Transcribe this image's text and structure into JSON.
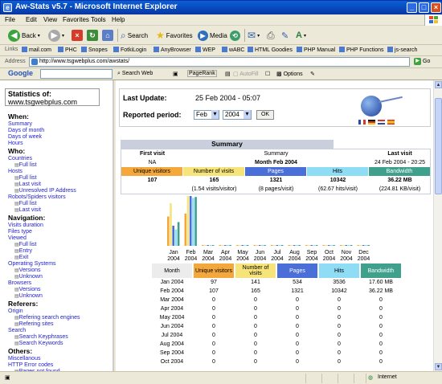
{
  "window": {
    "title": "Aw-Stats v5.7 - Microsoft Internet Explorer"
  },
  "menu": [
    "File",
    "Edit",
    "View",
    "Favorites",
    "Tools",
    "Help"
  ],
  "toolbar": {
    "back": "Back",
    "search": "Search",
    "favorites": "Favorites",
    "media": "Media"
  },
  "links": {
    "label": "Links",
    "items": [
      "mail.com",
      "PHC",
      "Snopes",
      "FotkiLogin",
      "AnyBrowser",
      "WEP",
      "wABC",
      "HTML Goodies",
      "PHP Manual",
      "PHP Functions",
      "js-search"
    ]
  },
  "address": {
    "label": "Address",
    "url": "http://www.tsgwebplus.com/awstats/",
    "go": "Go"
  },
  "googlebar": {
    "logo": "Google",
    "search_web": "Search Web",
    "pagerank": "PageRank",
    "autofill": "AutoFill",
    "options": "Options"
  },
  "sidebar": {
    "stats_label": "Statistics of:",
    "host": "www.tsgwebplus.com",
    "sections": [
      {
        "title": "When:",
        "links": [
          {
            "label": "Summary",
            "sub": false
          },
          {
            "label": "Days of month",
            "sub": false
          },
          {
            "label": "Days of week",
            "sub": false
          },
          {
            "label": "Hours",
            "sub": false
          }
        ]
      },
      {
        "title": "Who:",
        "links": [
          {
            "label": "Countries",
            "sub": false
          },
          {
            "label": "Full list",
            "sub": true
          },
          {
            "label": "Hosts",
            "sub": false
          },
          {
            "label": "Full list",
            "sub": true
          },
          {
            "label": "Last visit",
            "sub": true
          },
          {
            "label": "Unresolved IP Address",
            "sub": true
          },
          {
            "label": "Robots/Spiders visitors",
            "sub": false
          },
          {
            "label": "Full list",
            "sub": true
          },
          {
            "label": "Last visit",
            "sub": true
          }
        ]
      },
      {
        "title": "Navigation:",
        "links": [
          {
            "label": "Visits duration",
            "sub": false
          },
          {
            "label": "Files type",
            "sub": false
          },
          {
            "label": "Viewed",
            "sub": false
          },
          {
            "label": "Full list",
            "sub": true
          },
          {
            "label": "Entry",
            "sub": true
          },
          {
            "label": "Exit",
            "sub": true
          },
          {
            "label": "Operating Systems",
            "sub": false
          },
          {
            "label": "Versions",
            "sub": true
          },
          {
            "label": "Unknown",
            "sub": true
          },
          {
            "label": "Browsers",
            "sub": false
          },
          {
            "label": "Versions",
            "sub": true
          },
          {
            "label": "Unknown",
            "sub": true
          }
        ]
      },
      {
        "title": "Referers:",
        "links": [
          {
            "label": "Origin",
            "sub": false
          },
          {
            "label": "Refering search engines",
            "sub": true
          },
          {
            "label": "Refering sites",
            "sub": true
          },
          {
            "label": "Search",
            "sub": false
          },
          {
            "label": "Search Keyphrases",
            "sub": true
          },
          {
            "label": "Search Keywords",
            "sub": true
          }
        ]
      },
      {
        "title": "Others:",
        "links": [
          {
            "label": "Miscellanous",
            "sub": false
          },
          {
            "label": "HTTP Error codes",
            "sub": false
          },
          {
            "label": "Pages not found",
            "sub": true
          }
        ]
      }
    ]
  },
  "info": {
    "last_update_label": "Last Update:",
    "last_update_value": "25 Feb 2004 - 05:07",
    "period_label": "Reported period:",
    "month": "Feb",
    "year": "2004",
    "ok": "OK"
  },
  "summary": {
    "tab": "Summary",
    "first_visit_label": "First visit",
    "first_visit_value": "NA",
    "summary_label": "Summary",
    "month_label": "Month Feb 2004",
    "last_visit_label": "Last visit",
    "last_visit_value": "24 Feb 2004 - 20:25",
    "headers": [
      "Unique visitors",
      "Number of visits",
      "Pages",
      "Hits",
      "Bandwidth"
    ],
    "values": [
      "107",
      "165",
      "1321",
      "10342",
      "36.22 MB"
    ],
    "sub_values": [
      "",
      "(1.54 visits/visitor)",
      "(8 pages/visit)",
      "(62.67 hits/visit)",
      "(224.81 KB/visit)"
    ]
  },
  "colors": {
    "unique": "#F4A83C",
    "visits": "#F6E47B",
    "pages": "#4A6FD8",
    "hits": "#8EDDF5",
    "bandwidth": "#3FA08C"
  },
  "chart_data": {
    "type": "bar",
    "categories": [
      "Jan 2004",
      "Feb 2004",
      "Mar 2004",
      "Apr 2004",
      "May 2004",
      "Jun 2004",
      "Jul 2004",
      "Aug 2004",
      "Sep 2004",
      "Oct 2004",
      "Nov 2004",
      "Dec 2004"
    ],
    "series": [
      {
        "name": "Unique visitors",
        "values": [
          97,
          107,
          0,
          0,
          0,
          0,
          0,
          0,
          0,
          0,
          0,
          0
        ]
      },
      {
        "name": "Number of visits",
        "values": [
          141,
          165,
          0,
          0,
          0,
          0,
          0,
          0,
          0,
          0,
          0,
          0
        ]
      },
      {
        "name": "Pages",
        "values": [
          534,
          1321,
          0,
          0,
          0,
          0,
          0,
          0,
          0,
          0,
          0,
          0
        ]
      },
      {
        "name": "Hits",
        "values": [
          3536,
          10342,
          0,
          0,
          0,
          0,
          0,
          0,
          0,
          0,
          0,
          0
        ]
      },
      {
        "name": "Bandwidth",
        "values": [
          17.6,
          36.22,
          0,
          0,
          0,
          0,
          0,
          0,
          0,
          0,
          0,
          0
        ]
      }
    ]
  },
  "month_table": {
    "headers": [
      "Month",
      "Unique visitors",
      "Number of visits",
      "Pages",
      "Hits",
      "Bandwidth"
    ],
    "rows": [
      [
        "Jan 2004",
        "97",
        "141",
        "534",
        "3536",
        "17.60 MB"
      ],
      [
        "Feb 2004",
        "107",
        "165",
        "1321",
        "10342",
        "36.22 MB"
      ],
      [
        "Mar 2004",
        "0",
        "0",
        "0",
        "0",
        "0"
      ],
      [
        "Apr 2004",
        "0",
        "0",
        "0",
        "0",
        "0"
      ],
      [
        "May 2004",
        "0",
        "0",
        "0",
        "0",
        "0"
      ],
      [
        "Jun 2004",
        "0",
        "0",
        "0",
        "0",
        "0"
      ],
      [
        "Jul 2004",
        "0",
        "0",
        "0",
        "0",
        "0"
      ],
      [
        "Aug 2004",
        "0",
        "0",
        "0",
        "0",
        "0"
      ],
      [
        "Sep 2004",
        "0",
        "0",
        "0",
        "0",
        "0"
      ],
      [
        "Oct 2004",
        "0",
        "0",
        "0",
        "0",
        "0"
      ]
    ]
  },
  "status": {
    "zone": "Internet"
  }
}
